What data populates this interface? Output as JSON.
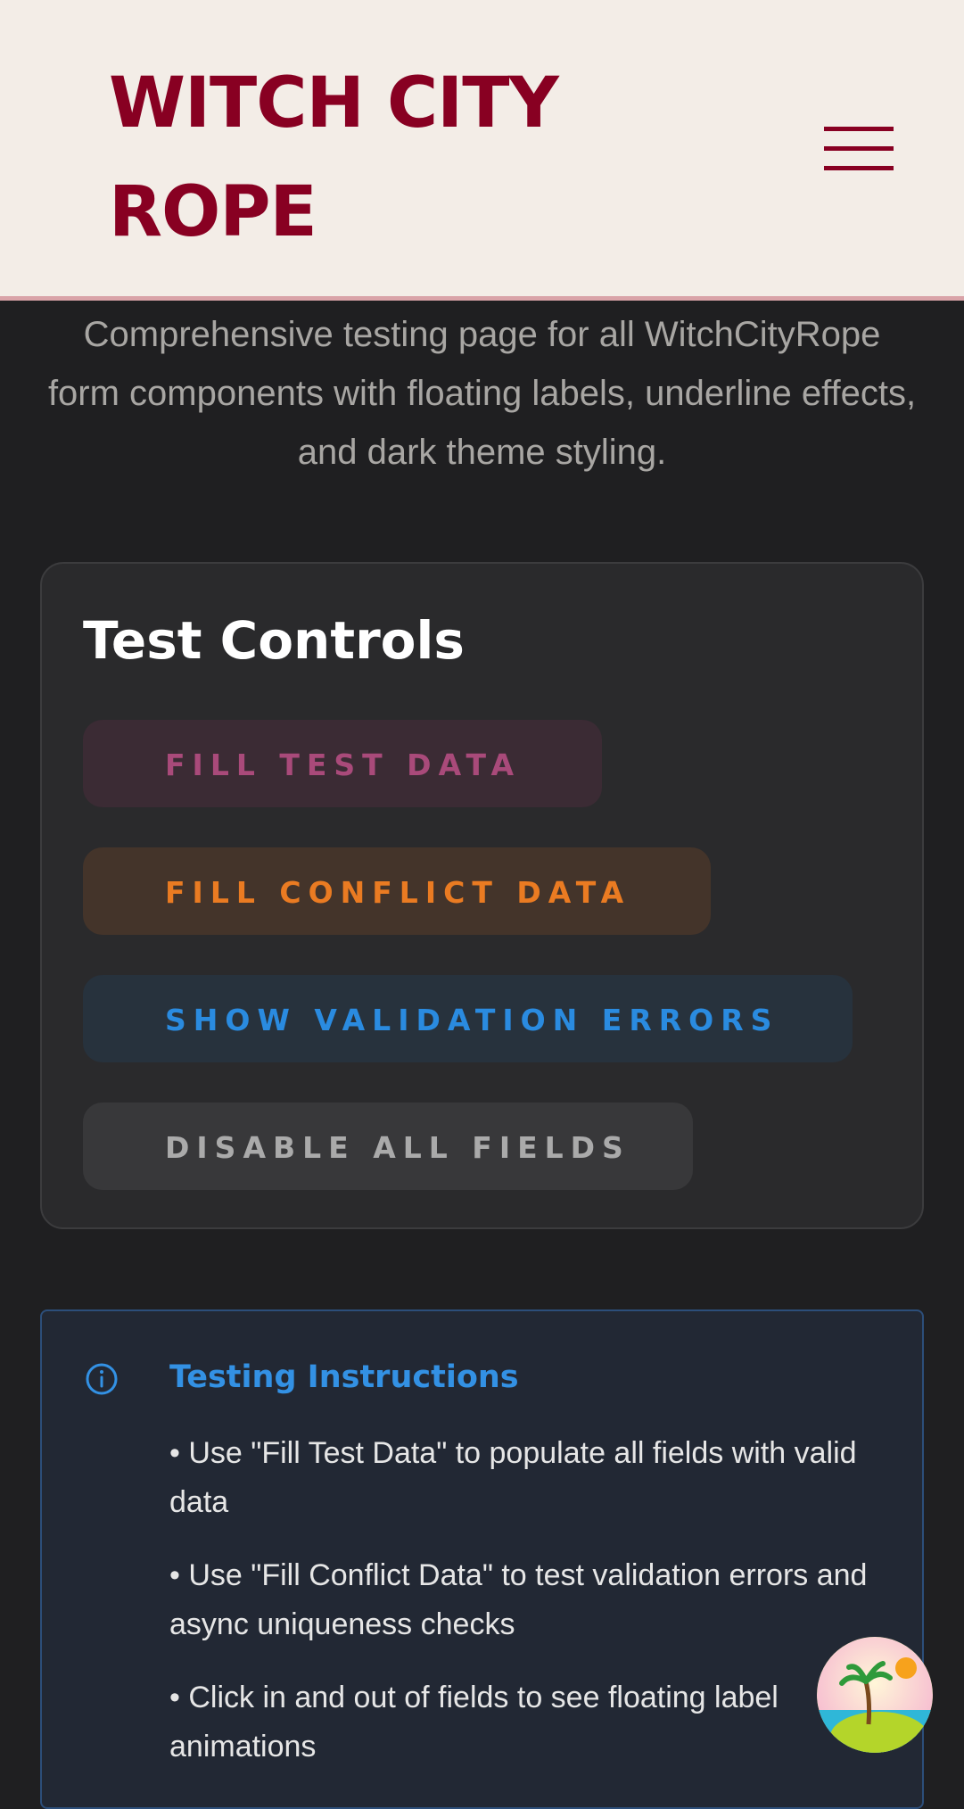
{
  "header": {
    "brand_line1": "WITCH CITY",
    "brand_line2": "ROPE",
    "menu_icon": "hamburger-menu-icon"
  },
  "subtitle": "Comprehensive testing page for all WitchCityRope form components with floating labels, underline effects, and dark theme styling.",
  "test_controls": {
    "title": "Test Controls",
    "buttons": [
      {
        "label": "FILL TEST DATA",
        "color": "#a94a7a"
      },
      {
        "label": "FILL CONFLICT DATA",
        "color": "#ea7b22"
      },
      {
        "label": "SHOW VALIDATION ERRORS",
        "color": "#2a8be0"
      },
      {
        "label": "DISABLE ALL FIELDS",
        "color": "#aaaaaa"
      }
    ]
  },
  "instructions": {
    "icon": "info-circle-icon",
    "title": "Testing Instructions",
    "items": [
      "• Use \"Fill Test Data\" to populate all fields with valid data",
      "• Use \"Fill Conflict Data\" to test validation errors and async uniqueness checks",
      "• Click in and out of fields to see floating label animations"
    ]
  },
  "colors": {
    "brand": "#880022",
    "page_background": "#1f1f21",
    "header_background": "#f3ede7",
    "info_accent": "#3391e4"
  },
  "floating_badge": {
    "icon": "tropical-island-icon"
  }
}
